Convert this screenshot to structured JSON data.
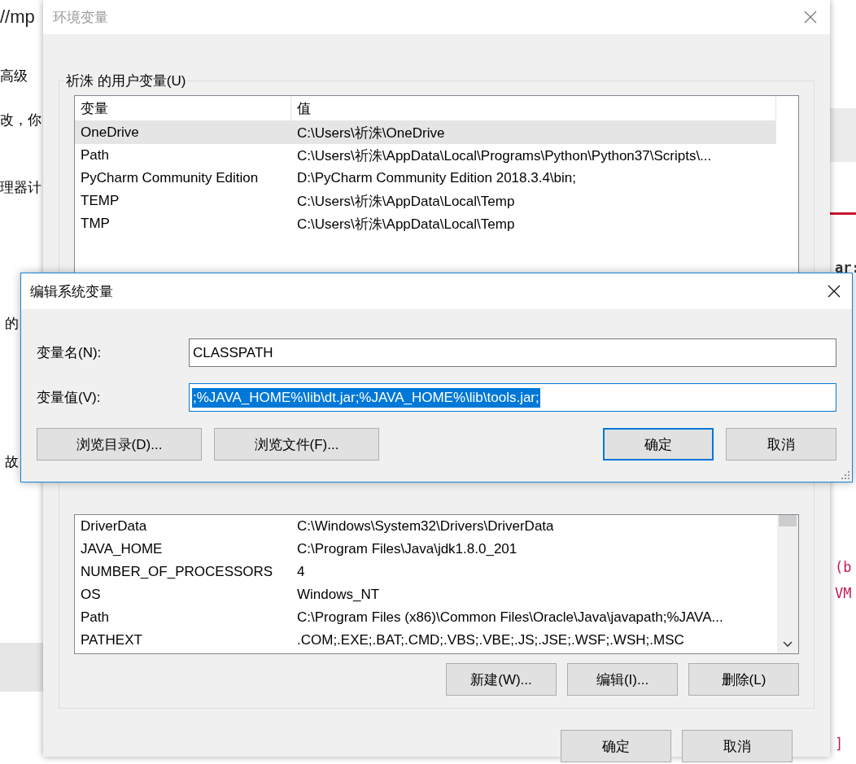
{
  "background_left": {
    "address_fragment": "//mp",
    "texts": [
      "高级",
      "改，你",
      "理器计",
      "的",
      "故"
    ]
  },
  "background_right": {
    "texts": [
      {
        "text": "ar:",
        "kind": "plain"
      },
      {
        "text": "(b",
        "kind": "keyword"
      },
      {
        "text": "VM",
        "kind": "keyword"
      },
      {
        "text": "]",
        "kind": "keyword"
      }
    ]
  },
  "env_dialog": {
    "title": "环境变量",
    "user_group": {
      "label": "祈洙 的用户变量(U)",
      "columns": [
        "变量",
        "值"
      ],
      "rows": [
        {
          "name": "OneDrive",
          "value": "C:\\Users\\祈洙\\OneDrive",
          "selected": true
        },
        {
          "name": "Path",
          "value": "C:\\Users\\祈洙\\AppData\\Local\\Programs\\Python\\Python37\\Scripts\\...",
          "selected": false
        },
        {
          "name": "PyCharm Community Edition",
          "value": "D:\\PyCharm Community Edition 2018.3.4\\bin;",
          "selected": false
        },
        {
          "name": "TEMP",
          "value": "C:\\Users\\祈洙\\AppData\\Local\\Temp",
          "selected": false
        },
        {
          "name": "TMP",
          "value": "C:\\Users\\祈洙\\AppData\\Local\\Temp",
          "selected": false
        }
      ]
    },
    "system_rows": [
      {
        "name": "DriverData",
        "value": "C:\\Windows\\System32\\Drivers\\DriverData",
        "selected": false
      },
      {
        "name": "JAVA_HOME",
        "value": "C:\\Program Files\\Java\\jdk1.8.0_201",
        "selected": false
      },
      {
        "name": "NUMBER_OF_PROCESSORS",
        "value": "4",
        "selected": false
      },
      {
        "name": "OS",
        "value": "Windows_NT",
        "selected": false
      },
      {
        "name": "Path",
        "value": "C:\\Program Files (x86)\\Common Files\\Oracle\\Java\\javapath;%JAVA...",
        "selected": false
      },
      {
        "name": "PATHEXT",
        "value": ".COM;.EXE;.BAT;.CMD;.VBS;.VBE;.JS;.JSE;.WSF;.WSH;.MSC",
        "selected": false
      }
    ],
    "system_buttons": [
      "新建(W)...",
      "编辑(I)...",
      "删除(L)"
    ],
    "buttons": [
      {
        "label": "确定",
        "default": false
      },
      {
        "label": "取消",
        "default": false
      }
    ]
  },
  "edit_dialog": {
    "title": "编辑系统变量",
    "fields": [
      {
        "label": "变量名(N):",
        "value": "CLASSPATH",
        "focused": false,
        "value_selected": false
      },
      {
        "label": "变量值(V):",
        "value": ";%JAVA_HOME%\\lib\\dt.jar;%JAVA_HOME%\\lib\\tools.jar;",
        "focused": true,
        "value_selected": true
      }
    ],
    "buttons": [
      {
        "label": "浏览目录(D)...",
        "default": false
      },
      {
        "label": "浏览文件(F)...",
        "default": false
      },
      {
        "label": "确定",
        "default": true
      },
      {
        "label": "取消",
        "default": false
      }
    ]
  }
}
